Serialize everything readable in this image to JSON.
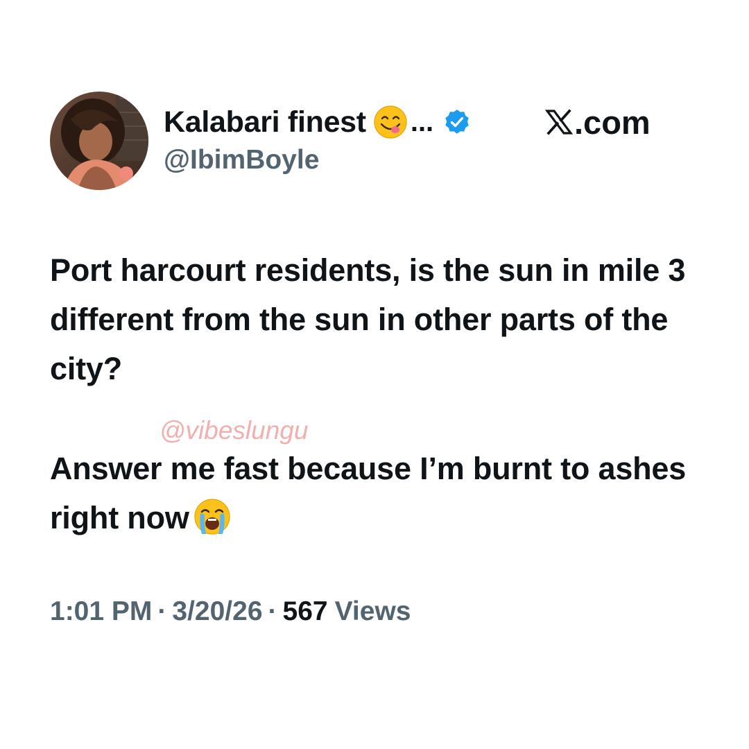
{
  "author": {
    "display_name": "Kalabari finest",
    "name_emoji": "face-savoring-food-emoji",
    "ellipsis": "...",
    "verified": true,
    "handle": "@IbimBoyle"
  },
  "site_label": ".com",
  "tweet": {
    "paragraph_1": "Port harcourt residents, is the sun in mile 3 different from the sun in other parts of the city?",
    "paragraph_2": "Answer me fast because I’m burnt to ashes right now",
    "trailing_emoji": "loudly-crying-face-emoji"
  },
  "watermark": "@vibeslungu",
  "meta": {
    "time": "1:01 PM",
    "separator": "·",
    "date": "3/20/26",
    "views_count": "567",
    "views_label": "Views"
  },
  "colors": {
    "text_primary": "#0f1419",
    "text_secondary": "#536471",
    "verified_blue": "#1d9bf0",
    "watermark": "#f2a0a0",
    "background": "#ffffff"
  }
}
